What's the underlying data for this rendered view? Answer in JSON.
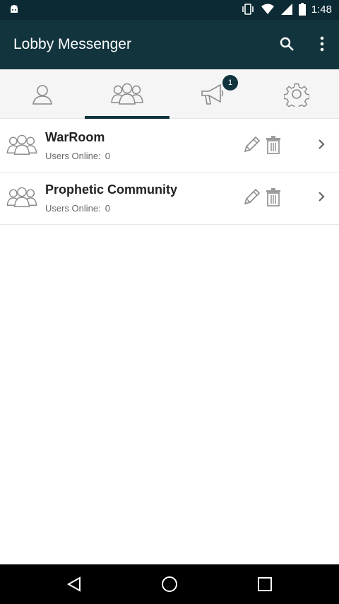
{
  "status_bar": {
    "time": "1:48",
    "icons": [
      "android-notification-icon",
      "vibrate-icon",
      "wifi-icon",
      "signal-icon",
      "battery-icon"
    ]
  },
  "app_bar": {
    "title": "Lobby Messenger",
    "actions": [
      "search-icon",
      "more-vert-icon"
    ]
  },
  "tabs": [
    {
      "name": "person-icon"
    },
    {
      "name": "group-icon",
      "selected": true
    },
    {
      "name": "megaphone-icon",
      "badge": "1"
    },
    {
      "name": "gear-icon"
    }
  ],
  "lobbies": [
    {
      "title": "WarRoom",
      "online_label": "Users Online:",
      "online_count": "0"
    },
    {
      "title": "Prophetic Community",
      "online_label": "Users Online:",
      "online_count": "0"
    }
  ],
  "colors": {
    "app_bar": "#12343d",
    "status_bar": "#0b2a33",
    "icon_gray": "#8a8a8a"
  },
  "nav_bar": [
    "back-icon",
    "home-icon",
    "recents-icon"
  ]
}
